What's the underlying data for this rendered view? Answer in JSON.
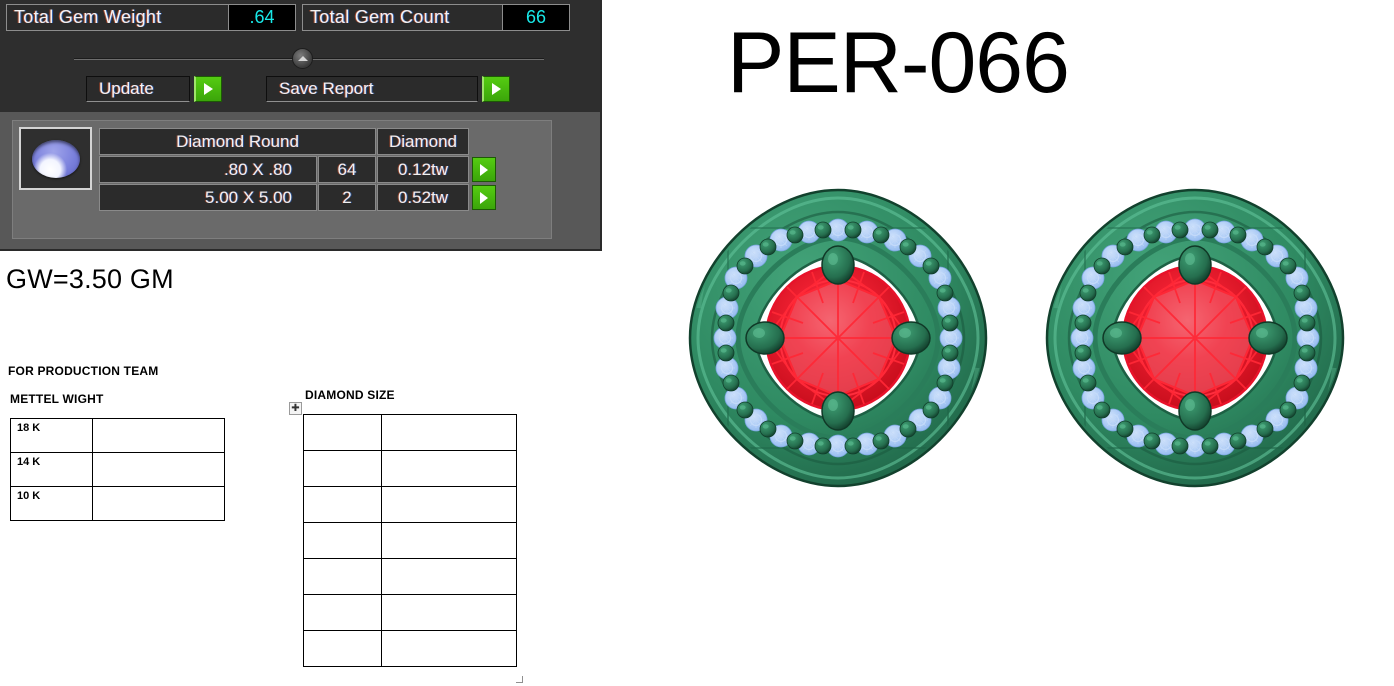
{
  "gem_panel": {
    "readouts": [
      {
        "label": "Total Gem Weight",
        "value": ".64"
      },
      {
        "label": "Total Gem Count",
        "value": "66"
      }
    ],
    "buttons": {
      "update": "Update",
      "save_report": "Save Report"
    },
    "gem_table": {
      "headers": [
        "Diamond Round",
        "Diamond"
      ],
      "rows": [
        {
          "size": ".80 X .80",
          "count": "64",
          "tw": "0.12tw"
        },
        {
          "size": "5.00 X 5.00",
          "count": "2",
          "tw": "0.52tw"
        }
      ]
    },
    "colors": {
      "panel_bg": "#585858",
      "panel_top_bg": "#2e2e2e",
      "readout_value": "#18e8e8",
      "green_button": "#47b80e",
      "cell_bg": "#2b2b2b"
    }
  },
  "document": {
    "gross_weight": "GW=3.50 GM",
    "production_heading": "FOR PRODUCTION TEAM",
    "metal_weight_heading": "METTEL WIGHT",
    "diamond_size_heading": "DIAMOND SIZE",
    "metal_table": {
      "rows": [
        {
          "karat": "18 K",
          "value": ""
        },
        {
          "karat": "14 K",
          "value": ""
        },
        {
          "karat": "10 K",
          "value": ""
        }
      ]
    },
    "diamond_table": {
      "row_count": 7,
      "rows": [
        {
          "left": "",
          "right": ""
        },
        {
          "left": "",
          "right": ""
        },
        {
          "left": "",
          "right": ""
        },
        {
          "left": "",
          "right": ""
        },
        {
          "left": "",
          "right": ""
        },
        {
          "left": "",
          "right": ""
        },
        {
          "left": "",
          "right": ""
        }
      ]
    }
  },
  "model": {
    "title": "PER-066",
    "render": {
      "view": "top-down pair of cushion halo stud earrings",
      "metal_color": "#2f8a62",
      "metal_dark": "#1d5c41",
      "pave_stone_color": "#a9c9f5",
      "center_stone_color": "#e8122a",
      "center_stone_highlight": "#f4626f",
      "count": 2
    }
  },
  "icons": {
    "collapse": "chevron-up-icon",
    "row_action": "play-arrow-icon",
    "gem_thumb": "gemstone-icon",
    "table_move": "move-handle-icon",
    "table_resize": "resize-handle-icon"
  }
}
